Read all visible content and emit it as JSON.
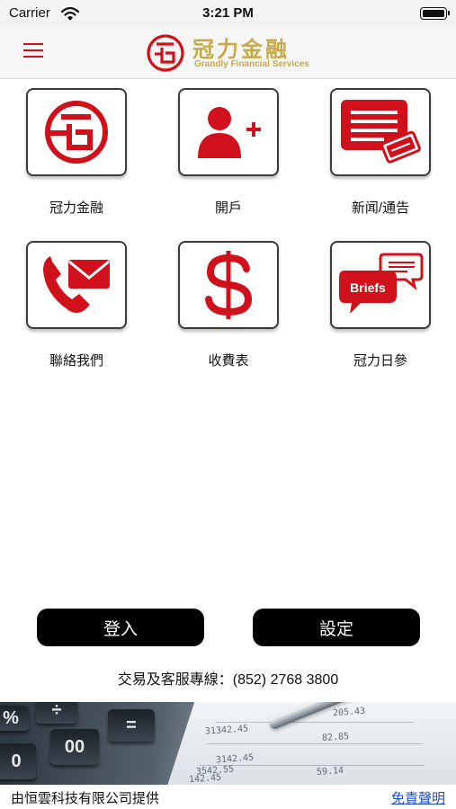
{
  "status_bar": {
    "carrier": "Carrier",
    "time": "3:21 PM"
  },
  "header": {
    "brand_name": "冠力金融",
    "brand_subtitle": "Grandly Financial Services",
    "menu_icon": "hamburger-menu-icon",
    "accent_color": "#d0111b",
    "brand_color": "#c8a94a"
  },
  "tiles": [
    {
      "label": "冠力金融",
      "icon": "company-logo-icon"
    },
    {
      "label": "開戶",
      "icon": "add-user-icon"
    },
    {
      "label": "新闻/通告",
      "icon": "news-icon"
    },
    {
      "label": "聯絡我們",
      "icon": "phone-mail-icon"
    },
    {
      "label": "收費表",
      "icon": "dollar-icon"
    },
    {
      "label": "冠力日參",
      "icon": "briefs-chat-icon",
      "icon_text": "Briefs"
    }
  ],
  "buttons": {
    "login": "登入",
    "settings": "設定"
  },
  "hotline": "交易及客服專線：(852) 2768 3800",
  "banner": {
    "image": "calculator-documents-photo",
    "keys": [
      "%",
      "÷",
      "0",
      "00",
      "="
    ],
    "paper_numbers": [
      "205.43",
      "31342.45",
      "3142.45",
      "82.85",
      "142.45",
      "3542.55",
      "59.14"
    ]
  },
  "footer": {
    "provider": "由恒雲科技有限公司提供",
    "disclaimer": "免責聲明"
  }
}
